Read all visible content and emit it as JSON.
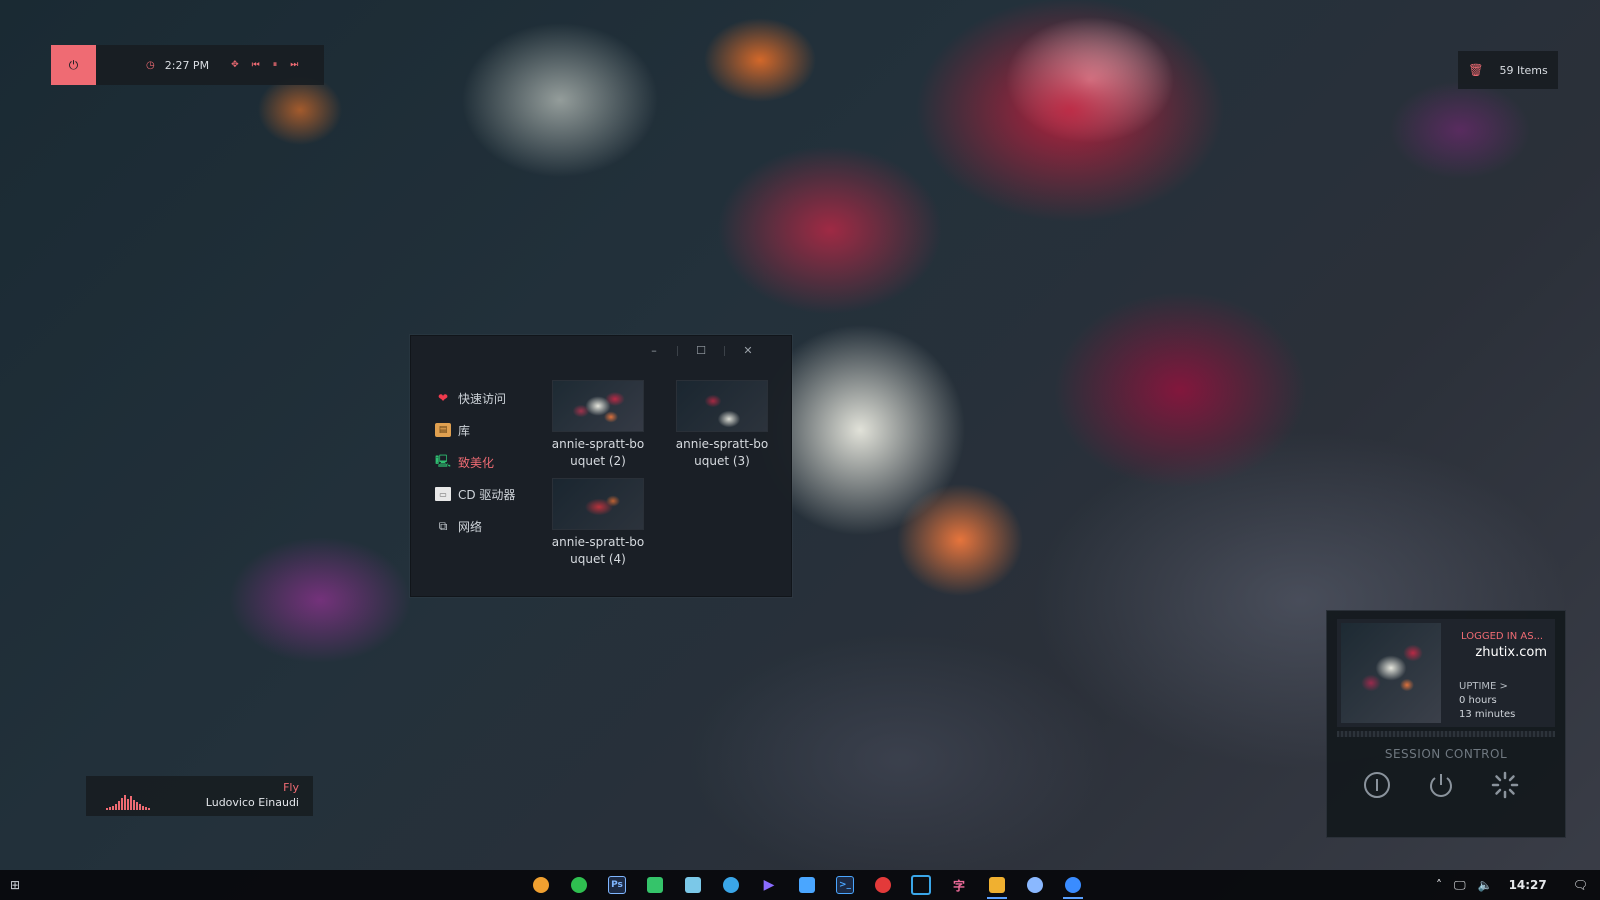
{
  "top_widget": {
    "clock_time": "2:27 PM"
  },
  "recycle_widget": {
    "items_label": "59 Items"
  },
  "explorer": {
    "controls": {
      "minimize": "–",
      "maximize": "☐",
      "close": "✕"
    },
    "nav": [
      {
        "label": "快速访问",
        "icon": "heart-icon"
      },
      {
        "label": "库",
        "icon": "library-icon"
      },
      {
        "label": "致美化",
        "icon": "computer-icon"
      },
      {
        "label": "CD 驱动器",
        "icon": "cd-drive-icon"
      },
      {
        "label": "网络",
        "icon": "network-icon"
      }
    ],
    "files": [
      {
        "name": "annie-spratt-bouquet (2)"
      },
      {
        "name": "annie-spratt-bouquet (3)"
      },
      {
        "name": "annie-spratt-bouquet (4)"
      }
    ]
  },
  "now_playing": {
    "title": "Fly",
    "artist": "Ludovico Einaudi"
  },
  "session": {
    "logged_in_label": "LOGGED IN AS...",
    "username": "zhutix.com",
    "uptime_label": "UPTIME >",
    "uptime_hours": "0 hours",
    "uptime_minutes": "13 minutes",
    "control_title": "SESSION CONTROL"
  },
  "taskbar": {
    "apps": [
      "pinwheel",
      "wechat",
      "photoshop",
      "chart-app",
      "image-viewer",
      "palette",
      "media-player",
      "clipboard",
      "terminal",
      "netease-music",
      "window-manager",
      "font-app",
      "file-explorer",
      "qq",
      "browser"
    ],
    "clock": "14:27"
  },
  "colors": {
    "accent": "#ef6b73",
    "panel": "#181d22",
    "taskbar": "#080a0d"
  }
}
